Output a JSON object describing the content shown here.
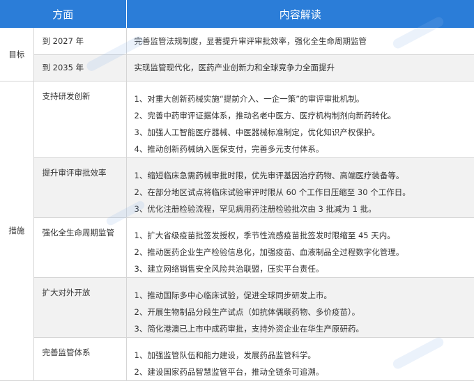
{
  "header": {
    "col_aspect": "方面",
    "col_content": "内容解读"
  },
  "sections": [
    {
      "category": "目标",
      "rows": [
        {
          "sub": "到 2027 年",
          "lines": [
            "完善监管法规制度，显著提升审评审批效率，强化全生命周期监管"
          ]
        },
        {
          "sub": "到 2035 年",
          "lines": [
            "实现监管现代化，医药产业创新力和全球竞争力全面提升"
          ]
        }
      ]
    },
    {
      "category": "措施",
      "rows": [
        {
          "sub": "支持研发创新",
          "lines": [
            "1、对重大创新药械实施“提前介入、一企一策”的审评审批机制。",
            "2、完善中药审评证据体系，推动名老中医方、医疗机构制剂向新药转化。",
            "3、加强人工智能医疗器械、中医器械标准制定，优化知识产权保护。",
            "4、推动创新药械纳入医保支付，完善多元支付体系。"
          ]
        },
        {
          "sub": "提升审评审批效率",
          "lines": [
            "1、缩短临床急需药械审批时限，优先审评基因治疗药物、高端医疗装备等。",
            "2、在部分地区试点将临床试验审评时限从 60 个工作日压缩至 30 个工作日。",
            "3、优化注册检验流程，罕见病用药注册检验批次由 3 批减为 1 批。"
          ]
        },
        {
          "sub": "强化全生命周期监管",
          "lines": [
            "1、扩大省级疫苗批签发授权，季节性流感疫苗批签发时限缩至 45 天内。",
            "2、推动医药企业生产检验信息化，加强疫苗、血液制品全过程数字化管理。",
            "3、建立网络销售安全风险共治联盟，压实平台责任。"
          ]
        },
        {
          "sub": "扩大对外开放",
          "lines": [
            "1、推动国际多中心临床试验，促进全球同步研发上市。",
            "2、开展生物制品分段生产试点（如抗体偶联药物、多价疫苗）。",
            "3、简化港澳已上市中成药审批，支持外资企业在华生产原研药。"
          ]
        },
        {
          "sub": "完善监管体系",
          "lines": [
            "1、加强监管队伍和能力建设，发展药品监管科学。",
            "2、建设国家药品智慧监管平台，推动全链条可追溯。"
          ]
        }
      ]
    }
  ]
}
